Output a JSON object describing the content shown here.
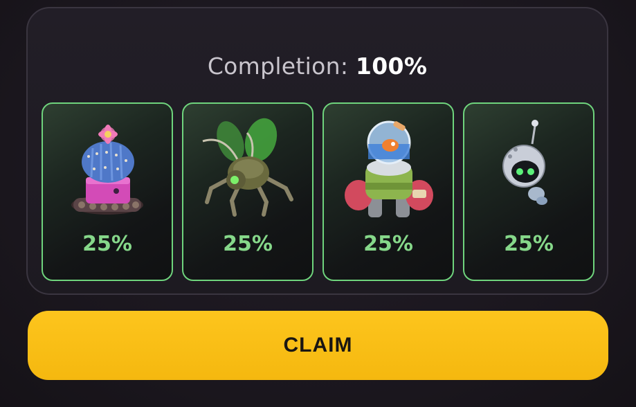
{
  "completion": {
    "label": "Completion: ",
    "value": "100%"
  },
  "cards": [
    {
      "name": "cactus-tank-robot",
      "percent": "25%"
    },
    {
      "name": "bug-robot",
      "percent": "25%"
    },
    {
      "name": "fishbowl-mech-robot",
      "percent": "25%"
    },
    {
      "name": "floating-orb-robot",
      "percent": "25%"
    }
  ],
  "claim_label": "CLAIM",
  "colors": {
    "accent_yellow": "#fdc51d",
    "card_border": "#6fd47d",
    "percent_text": "#86d88a"
  }
}
